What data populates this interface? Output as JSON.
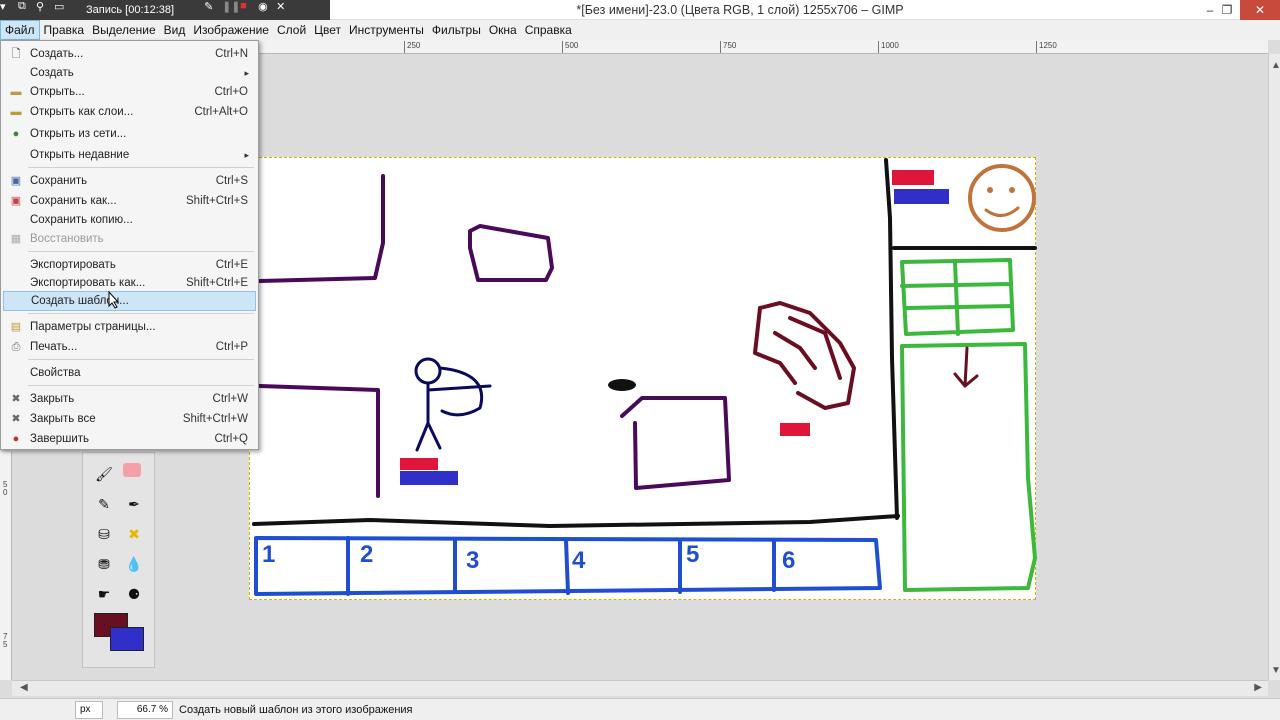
{
  "recorder": {
    "title": "Запись [00:12:38]"
  },
  "window": {
    "title": "*[Без имени]-23.0 (Цвета RGB, 1 слой) 1255x706 – GIMP"
  },
  "menubar": {
    "items": [
      "Файл",
      "Правка",
      "Выделение",
      "Вид",
      "Изображение",
      "Слой",
      "Цвет",
      "Инструменты",
      "Фильтры",
      "Окна",
      "Справка"
    ]
  },
  "ruler": {
    "top_ticks": [
      "250",
      "500",
      "750",
      "1000",
      "1250"
    ],
    "left_ticks": [
      "5",
      "0",
      "0",
      "7",
      "5"
    ]
  },
  "file_menu": {
    "items": [
      {
        "label": "Создать...",
        "shortcut": "Ctrl+N",
        "icon": "new-file-icon"
      },
      {
        "label": "Создать",
        "shortcut": "",
        "submenu": true
      },
      {
        "label": "Открыть...",
        "shortcut": "Ctrl+O",
        "icon": "open-folder-icon"
      },
      {
        "label": "Открыть как слои...",
        "shortcut": "Ctrl+Alt+O",
        "icon": "open-layers-icon"
      },
      {
        "label": "Открыть из сети...",
        "shortcut": "",
        "icon": "globe-icon"
      },
      {
        "label": "Открыть недавние",
        "shortcut": "",
        "submenu": true
      },
      {
        "label": "Сохранить",
        "shortcut": "Ctrl+S",
        "icon": "save-icon"
      },
      {
        "label": "Сохранить как...",
        "shortcut": "Shift+Ctrl+S",
        "icon": "save-as-icon"
      },
      {
        "label": "Сохранить копию...",
        "shortcut": ""
      },
      {
        "label": "Восстановить",
        "shortcut": "",
        "icon": "revert-icon",
        "disabled": true
      },
      {
        "label": "Экспортировать",
        "shortcut": "Ctrl+E"
      },
      {
        "label": "Экспортировать как...",
        "shortcut": "Shift+Ctrl+E"
      },
      {
        "label": "Создать шаблон...",
        "shortcut": "",
        "highlight": true
      },
      {
        "label": "Параметры страницы...",
        "shortcut": "",
        "icon": "page-setup-icon"
      },
      {
        "label": "Печать...",
        "shortcut": "Ctrl+P",
        "icon": "print-icon"
      },
      {
        "label": "Свойства",
        "shortcut": ""
      },
      {
        "label": "Закрыть",
        "shortcut": "Ctrl+W",
        "icon": "close-icon"
      },
      {
        "label": "Закрыть все",
        "shortcut": "Shift+Ctrl+W",
        "icon": "close-all-icon"
      },
      {
        "label": "Завершить",
        "shortcut": "Ctrl+Q",
        "icon": "quit-icon"
      }
    ]
  },
  "drawing": {
    "cells": [
      "1",
      "2",
      "3",
      "4",
      "5",
      "6"
    ]
  },
  "status": {
    "unit": "px",
    "zoom": "66.7 %",
    "message": "Создать новый шаблон из этого изображения"
  },
  "colors": {
    "foreground": "#6a0f22",
    "background": "#3030c8",
    "highlight": "#cde6f7"
  }
}
